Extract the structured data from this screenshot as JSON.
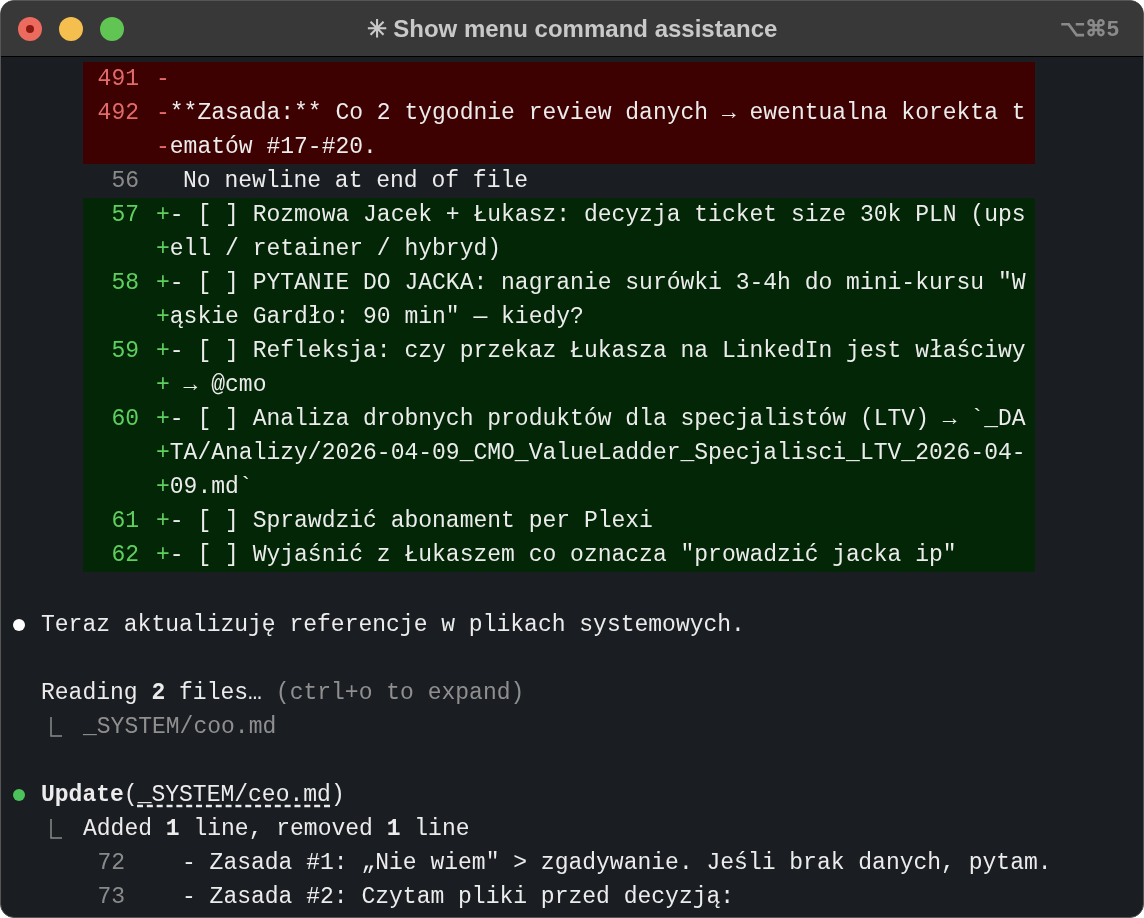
{
  "window": {
    "title": "✳ Show menu command assistance",
    "shortcut": "⌥⌘5"
  },
  "diff": [
    {
      "kind": "removed",
      "number": "491",
      "segments": [
        "-"
      ]
    },
    {
      "kind": "removed",
      "number": "492",
      "segments": [
        "-**Zasada:** Co 2 tygodnie review danych → ewentualna korekta t",
        "-ematów #17-#20."
      ]
    },
    {
      "kind": "context",
      "number": "56",
      "segments": [
        "No newline at end of file"
      ]
    },
    {
      "kind": "added",
      "number": "57",
      "segments": [
        "+- [ ] Rozmowa Jacek + Łukasz: decyzja ticket size 30k PLN (ups",
        "+ell / retainer / hybryd)"
      ]
    },
    {
      "kind": "added",
      "number": "58",
      "segments": [
        "+- [ ] PYTANIE DO JACKA: nagranie surówki 3-4h do mini-kursu \"W",
        "+ąskie Gardło: 90 min\" — kiedy?"
      ]
    },
    {
      "kind": "added",
      "number": "59",
      "segments": [
        "+- [ ] Refleksja: czy przekaz Łukasza na LinkedIn jest właściwy",
        "+ → @cmo"
      ]
    },
    {
      "kind": "added",
      "number": "60",
      "segments": [
        "+- [ ] Analiza drobnych produktów dla specjalistów (LTV) → `_DA",
        "+TA/Analizy/2026-04-09_CMO_ValueLadder_Specjalisci_LTV_2026-04-",
        "+09.md`"
      ]
    },
    {
      "kind": "added",
      "number": "61",
      "segments": [
        "+- [ ] Sprawdzić abonament per Plexi"
      ]
    },
    {
      "kind": "added",
      "number": "62",
      "segments": [
        "+- [ ] Wyjaśnić z Łukaszem co oznacza \"prowadzić jacka ip\""
      ]
    }
  ],
  "messages": [
    {
      "kind": "message",
      "color": "#ffffff",
      "text": "Teraz aktualizuję referencje w plikach systemowych."
    },
    {
      "kind": "status",
      "text": "Reading **2** files…",
      "hint": "(ctrl+o to expand)",
      "result": "_SYSTEM/coo.md"
    },
    {
      "kind": "tool",
      "color": "#4cc35a",
      "tool": "Update",
      "open_paren": "(",
      "target": "_SYSTEM/ceo.md",
      "close_paren": ")",
      "result": "Added **1** line, removed **1** line",
      "lines": [
        {
          "number": "72",
          "text": "- Zasada #1: „Nie wiem\" > zgadywanie. Jeśli brak danych, pytam."
        },
        {
          "number": "73",
          "text": "- Zasada #2: Czytam pliki przed decyzją:"
        }
      ]
    }
  ]
}
